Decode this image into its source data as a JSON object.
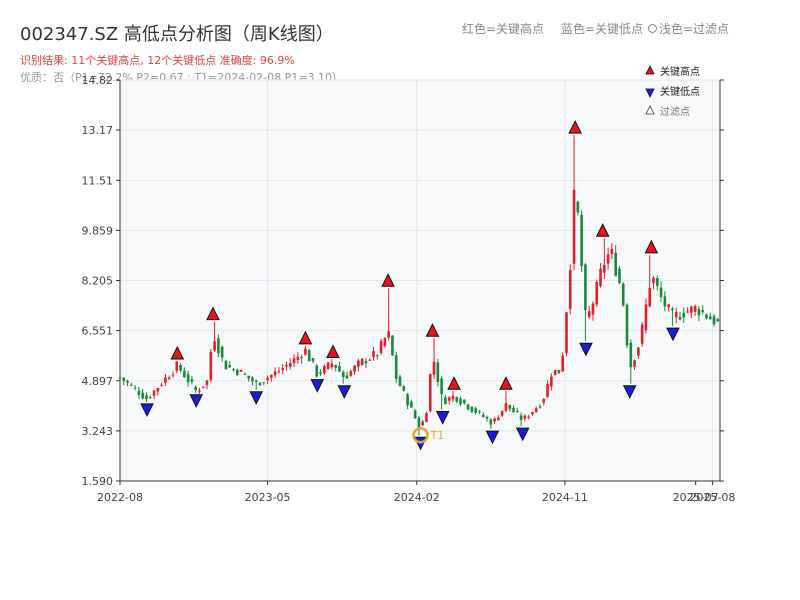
{
  "header": {
    "title": "002347.SZ 高低点分析图（周K线图）",
    "legend_red": "红色=关键高点",
    "legend_blue": "蓝色=关键低点",
    "legend_light": "浅色=过滤点",
    "summary": "识别结果: 11个关键高点, 12个关键低点  准确度: 96.9%",
    "detail": "优质：否（P1=72.2%  P2=0.67  ; T1=2024-02-08 P1=3.10）"
  },
  "colors": {
    "up": "#e0202a",
    "down": "#1a8a3a",
    "high_marker": "#e8141c",
    "low_marker": "#1c1ce0",
    "t1_ring": "#f0a030",
    "plot_bg": "#f7f8fa",
    "grid": "#e3e6ea"
  },
  "chart_data": {
    "type": "candlestick",
    "title": "002347.SZ 高低点分析图（周K线图）",
    "y_ticks": [
      "1.590",
      "3.243",
      "4.897",
      "6.551",
      "8.205",
      "9.859",
      "11.51",
      "13.17",
      "14.82"
    ],
    "ylim": [
      1.59,
      14.82
    ],
    "x_ticks": [
      "2022-08",
      "2023-05",
      "2024-02",
      "2024-11",
      "2025-08"
    ],
    "x_tick_overlap_label": "2025-07",
    "xlim": [
      "2022-08-01",
      "2025-08-15"
    ],
    "grid": true,
    "legend_position": "top-right",
    "legend": {
      "high": "关键高点",
      "low": "关键低点",
      "filtered": "过滤点"
    },
    "t1_label": "T1",
    "t1": {
      "date": "2024-02-08",
      "price": 3.1
    },
    "key_highs": [
      {
        "date": "2022-11-15",
        "price": 5.55
      },
      {
        "date": "2023-01-20",
        "price": 6.85
      },
      {
        "date": "2023-07-10",
        "price": 6.05
      },
      {
        "date": "2023-08-30",
        "price": 5.6
      },
      {
        "date": "2023-12-10",
        "price": 7.95
      },
      {
        "date": "2024-03-01",
        "price": 6.3
      },
      {
        "date": "2024-04-10",
        "price": 4.55
      },
      {
        "date": "2024-07-15",
        "price": 4.55
      },
      {
        "date": "2024-11-20",
        "price": 13.0
      },
      {
        "date": "2025-01-10",
        "price": 9.6
      },
      {
        "date": "2025-04-10",
        "price": 9.05
      }
    ],
    "key_lows": [
      {
        "date": "2022-09-20",
        "price": 4.2
      },
      {
        "date": "2022-12-20",
        "price": 4.5
      },
      {
        "date": "2023-04-10",
        "price": 4.6
      },
      {
        "date": "2023-08-01",
        "price": 5.0
      },
      {
        "date": "2023-09-20",
        "price": 4.8
      },
      {
        "date": "2024-02-08",
        "price": 3.1
      },
      {
        "date": "2024-03-20",
        "price": 3.95
      },
      {
        "date": "2024-06-20",
        "price": 3.3
      },
      {
        "date": "2024-08-15",
        "price": 3.4
      },
      {
        "date": "2024-12-10",
        "price": 6.2
      },
      {
        "date": "2025-03-01",
        "price": 4.8
      },
      {
        "date": "2025-05-20",
        "price": 6.7
      }
    ],
    "anchors": [
      [
        "2022-08-01",
        5.0
      ],
      [
        "2022-09-20",
        4.3
      ],
      [
        "2022-10-20",
        4.9
      ],
      [
        "2022-11-15",
        5.4
      ],
      [
        "2022-12-20",
        4.55
      ],
      [
        "2023-01-10",
        4.9
      ],
      [
        "2023-01-20",
        6.5
      ],
      [
        "2023-02-10",
        5.4
      ],
      [
        "2023-03-10",
        5.2
      ],
      [
        "2023-04-10",
        4.8
      ],
      [
        "2023-05-20",
        5.2
      ],
      [
        "2023-06-20",
        5.6
      ],
      [
        "2023-07-10",
        5.9
      ],
      [
        "2023-08-01",
        5.1
      ],
      [
        "2023-08-30",
        5.5
      ],
      [
        "2023-09-20",
        5.0
      ],
      [
        "2023-10-20",
        5.5
      ],
      [
        "2023-11-20",
        5.8
      ],
      [
        "2023-12-10",
        6.5
      ],
      [
        "2023-12-25",
        5.0
      ],
      [
        "2024-01-15",
        4.2
      ],
      [
        "2024-02-08",
        3.3
      ],
      [
        "2024-02-20",
        4.0
      ],
      [
        "2024-03-01",
        5.8
      ],
      [
        "2024-03-20",
        4.2
      ],
      [
        "2024-04-10",
        4.4
      ],
      [
        "2024-05-10",
        4.0
      ],
      [
        "2024-06-20",
        3.5
      ],
      [
        "2024-07-15",
        4.1
      ],
      [
        "2024-08-15",
        3.6
      ],
      [
        "2024-09-20",
        4.2
      ],
      [
        "2024-10-08",
        5.2
      ],
      [
        "2024-10-25",
        5.2
      ],
      [
        "2024-11-10",
        8.5
      ],
      [
        "2024-11-20",
        11.5
      ],
      [
        "2024-12-10",
        6.8
      ],
      [
        "2024-12-25",
        7.6
      ],
      [
        "2025-01-10",
        8.7
      ],
      [
        "2025-01-25",
        9.2
      ],
      [
        "2025-02-15",
        7.8
      ],
      [
        "2025-03-01",
        5.3
      ],
      [
        "2025-03-20",
        6.2
      ],
      [
        "2025-04-10",
        8.4
      ],
      [
        "2025-05-01",
        7.5
      ],
      [
        "2025-05-20",
        7.0
      ],
      [
        "2025-07-01",
        7.3
      ],
      [
        "2025-08-10",
        6.8
      ]
    ]
  }
}
